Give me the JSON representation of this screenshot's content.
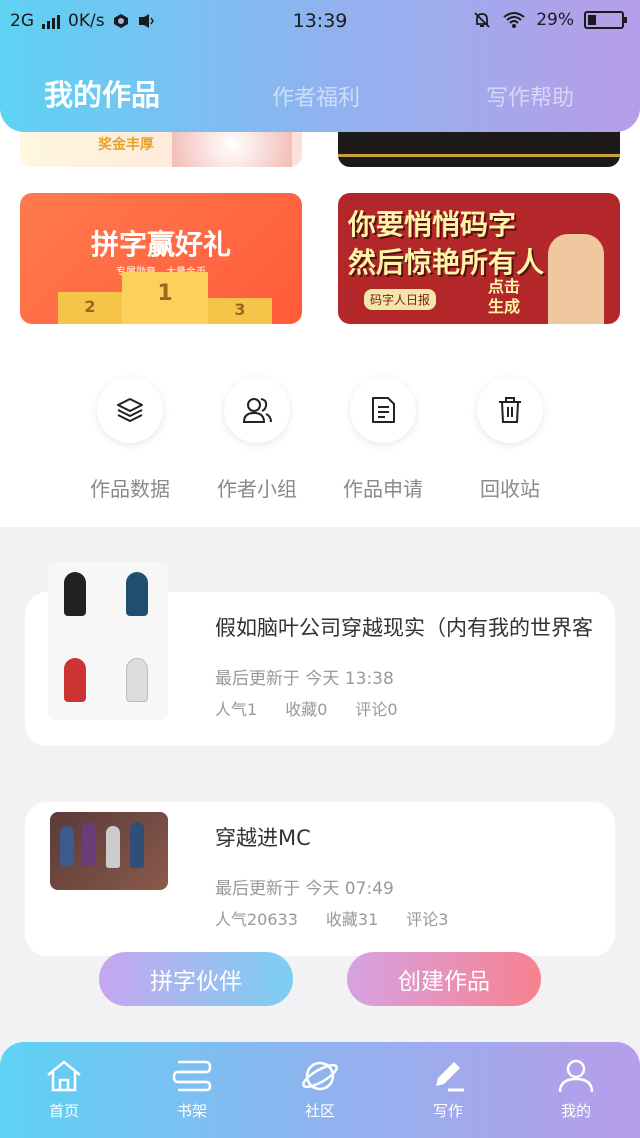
{
  "status_bar": {
    "network": "2G",
    "speed": "0K/s",
    "time": "13:39",
    "battery": "29%"
  },
  "header": {
    "tabs": [
      {
        "label": "我的作品",
        "active": true
      },
      {
        "label": "作者福利",
        "active": false
      },
      {
        "label": "写作帮助",
        "active": false
      }
    ]
  },
  "banners": {
    "top_left_text": "奖金丰厚",
    "contest": {
      "title": "拼字赢好礼",
      "subtitle": "专属勋章、大量金币",
      "podium": [
        "2",
        "1",
        "3"
      ]
    },
    "mazi": {
      "line1": "你要悄悄码字",
      "line2": "然后惊艳所有人",
      "tag": "码字人日报",
      "click": "点击\n生成"
    }
  },
  "quick_actions": [
    {
      "label": "作品数据",
      "icon": "layers-icon"
    },
    {
      "label": "作者小组",
      "icon": "group-icon"
    },
    {
      "label": "作品申请",
      "icon": "document-icon"
    },
    {
      "label": "回收站",
      "icon": "trash-icon"
    }
  ],
  "works": [
    {
      "title": "假如脑叶公司穿越现实（内有我的世界客",
      "updated": "最后更新于 今天 13:38",
      "popularity": "人气1",
      "favorites": "收藏0",
      "comments": "评论0"
    },
    {
      "title": "穿越进MC",
      "updated": "最后更新于 今天 07:49",
      "popularity": "人气20633",
      "favorites": "收藏31",
      "comments": "评论3"
    }
  ],
  "buttons": {
    "partner": "拼字伙伴",
    "create": "创建作品"
  },
  "bottom_nav": [
    {
      "label": "首页",
      "icon": "home-icon"
    },
    {
      "label": "书架",
      "icon": "bookshelf-icon"
    },
    {
      "label": "社区",
      "icon": "planet-icon"
    },
    {
      "label": "写作",
      "icon": "pen-icon"
    },
    {
      "label": "我的",
      "icon": "user-icon"
    }
  ],
  "colors": {
    "gradient_start": "#5ed2f3",
    "gradient_end": "#b79de9"
  }
}
